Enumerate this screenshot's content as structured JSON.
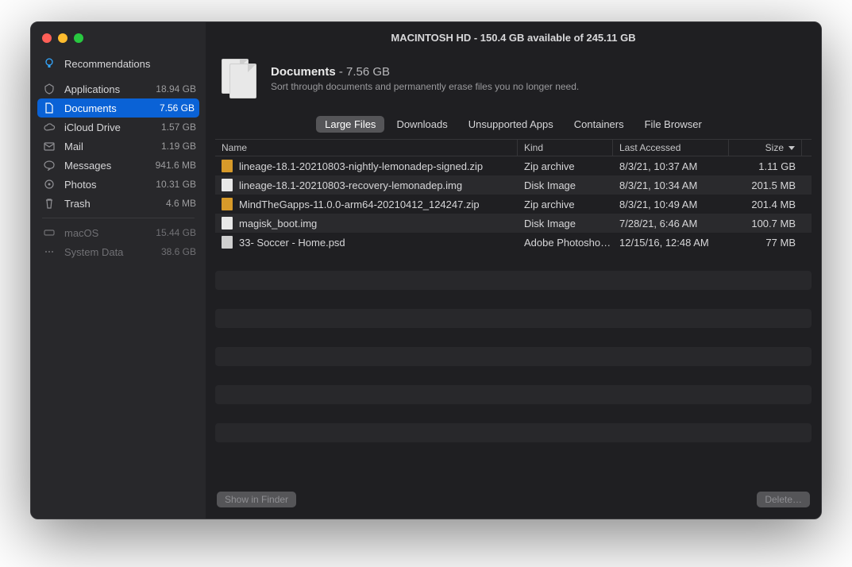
{
  "title": "MACINTOSH HD - 150.4 GB available of 245.11 GB",
  "header": {
    "heading": "Documents",
    "size": " - 7.56 GB",
    "desc": "Sort through documents and permanently erase files you no longer need."
  },
  "sidebar": {
    "recommend": "Recommendations",
    "items": [
      {
        "label": "Applications",
        "value": "18.94 GB"
      },
      {
        "label": "Documents",
        "value": "7.56 GB"
      },
      {
        "label": "iCloud Drive",
        "value": "1.57 GB"
      },
      {
        "label": "Mail",
        "value": "1.19 GB"
      },
      {
        "label": "Messages",
        "value": "941.6 MB"
      },
      {
        "label": "Photos",
        "value": "10.31 GB"
      },
      {
        "label": "Trash",
        "value": "4.6 MB"
      }
    ],
    "sys": [
      {
        "label": "macOS",
        "value": "15.44 GB"
      },
      {
        "label": "System Data",
        "value": "38.6 GB"
      }
    ]
  },
  "tabs": [
    "Large Files",
    "Downloads",
    "Unsupported Apps",
    "Containers",
    "File Browser"
  ],
  "columns": {
    "name": "Name",
    "kind": "Kind",
    "accessed": "Last Accessed",
    "size": "Size"
  },
  "rows": [
    {
      "icon": "zip",
      "name": "lineage-18.1-20210803-nightly-lemonadep-signed.zip",
      "kind": "Zip archive",
      "accessed": "8/3/21, 10:37 AM",
      "size": "1.11 GB"
    },
    {
      "icon": "img",
      "name": "lineage-18.1-20210803-recovery-lemonadep.img",
      "kind": "Disk Image",
      "accessed": "8/3/21, 10:34 AM",
      "size": "201.5 MB"
    },
    {
      "icon": "zip",
      "name": "MindTheGapps-11.0.0-arm64-20210412_124247.zip",
      "kind": "Zip archive",
      "accessed": "8/3/21, 10:49 AM",
      "size": "201.4 MB"
    },
    {
      "icon": "img",
      "name": "magisk_boot.img",
      "kind": "Disk Image",
      "accessed": "7/28/21, 6:46 AM",
      "size": "100.7 MB"
    },
    {
      "icon": "psd",
      "name": "33- Soccer - Home.psd",
      "kind": "Adobe Photosho…",
      "accessed": "12/15/16, 12:48 AM",
      "size": "77 MB"
    }
  ],
  "footer": {
    "show": "Show in Finder",
    "delete": "Delete…"
  }
}
